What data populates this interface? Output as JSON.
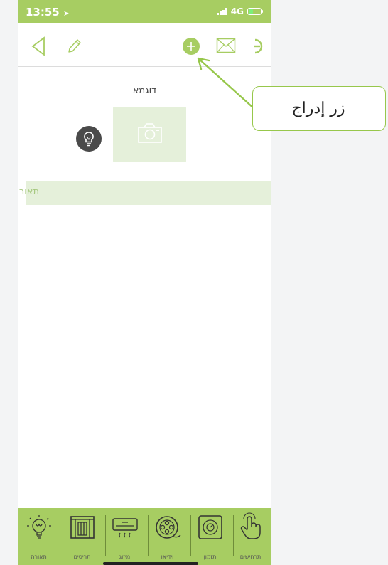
{
  "status_bar": {
    "time": "13:55",
    "network": "4G"
  },
  "toolbar": {
    "icons": [
      "back-icon",
      "edit-icon",
      "add-icon",
      "mail-icon",
      "refresh-icon"
    ]
  },
  "content": {
    "title": "דוגמא",
    "section_label": "תאורה"
  },
  "callout": {
    "text": "زر إدراج"
  },
  "bottom_nav": {
    "items": [
      {
        "label": "תאורה",
        "icon": "lightbulb-icon"
      },
      {
        "label": "תריסים",
        "icon": "shutters-icon"
      },
      {
        "label": "מיזוג",
        "icon": "air-conditioner-icon"
      },
      {
        "label": "וידיאו",
        "icon": "film-reel-icon"
      },
      {
        "label": "תזמון",
        "icon": "timer-icon"
      },
      {
        "label": "תרחישים",
        "icon": "touch-icon"
      }
    ]
  },
  "colors": {
    "accent": "#a7cd62",
    "pale_green": "#e5f0da",
    "callout_border": "#97c74b"
  }
}
